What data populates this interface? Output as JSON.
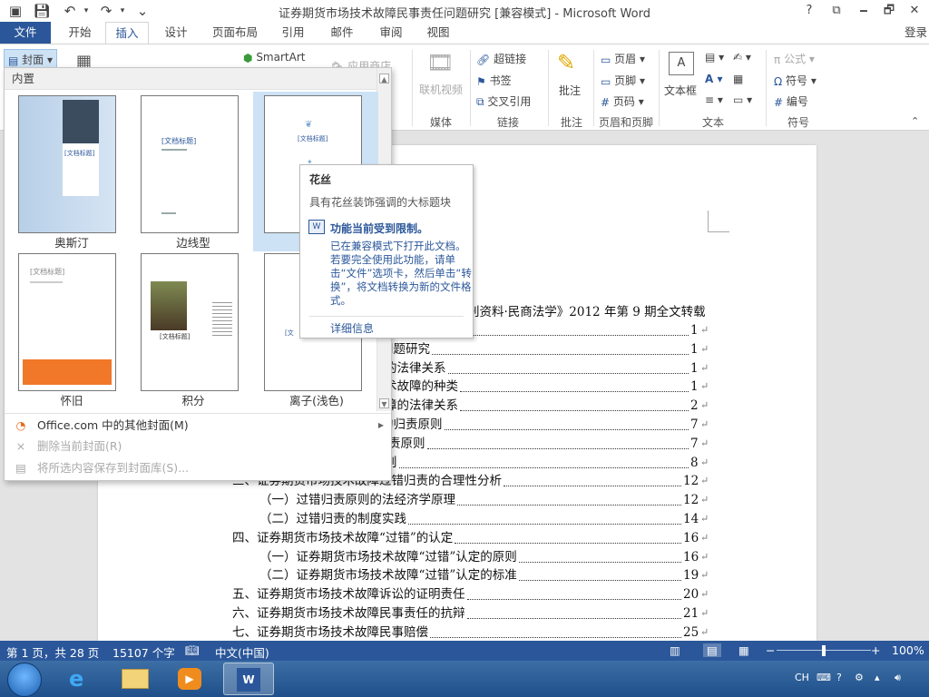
{
  "app": {
    "title": "证券期货市场技术故障民事责任问题研究 [兼容模式] - Microsoft Word",
    "window_buttons": [
      "?",
      "⧉",
      "🗕",
      "🗗",
      "✕"
    ]
  },
  "tabs": {
    "file": "文件",
    "items": [
      "开始",
      "插入",
      "设计",
      "页面布局",
      "引用",
      "邮件",
      "审阅",
      "视图"
    ],
    "active": "插入",
    "login": "登录"
  },
  "ribbon": {
    "cover_button": "封面",
    "smartart": "SmartArt",
    "app_store": "应用商店",
    "online_video": "联机视频",
    "media_group": "媒体",
    "hyperlink": "超链接",
    "bookmark": "书签",
    "cross_ref": "交叉引用",
    "links_group": "链接",
    "comment": "批注",
    "comment_group": "批注",
    "header": "页眉",
    "footer": "页脚",
    "page_number": "页码",
    "header_footer_group": "页眉和页脚",
    "textbox": "文本框",
    "text_group": "文本",
    "equation": "公式",
    "symbol": "符号",
    "numbering": "编号",
    "symbol_group": "符号"
  },
  "gallery": {
    "header": "内置",
    "covers": [
      {
        "label": "奥斯汀",
        "title": "[文档标题]"
      },
      {
        "label": "边线型",
        "title": "[文档标题]"
      },
      {
        "label": "",
        "title": "[文档标题]"
      },
      {
        "label": "怀旧",
        "title": "[文档标题]"
      },
      {
        "label": "积分",
        "title": "[文档标题]"
      },
      {
        "label": "离子(浅色)",
        "title": "[文"
      }
    ],
    "menu": [
      {
        "label": "Office.com 中的其他封面(M)",
        "enabled": true
      },
      {
        "label": "删除当前封面(R)",
        "enabled": false
      },
      {
        "label": "将所选内容保存到封面库(S)...",
        "enabled": false
      }
    ]
  },
  "tooltip": {
    "title": "花丝",
    "description": "具有花丝装饰强调的大标题块",
    "warning_title": "功能当前受到限制。",
    "warning_body": "已在兼容模式下打开此文档。若要完全使用此功能，请单击“文件”选项卡，然后单击“转换”，将文档转换为新的文件格式。",
    "more_info": "详细信息"
  },
  "document": {
    "source_line": "刊资料·民商法学》2012 年第 9 期全文转载",
    "toc": [
      {
        "text": "",
        "page": "1"
      },
      {
        "text": "问题研究",
        "page": "1"
      },
      {
        "text": "的法律关系",
        "page": "1"
      },
      {
        "text": "术故障的种类",
        "page": "1"
      },
      {
        "text": "障的法律关系",
        "page": "2"
      },
      {
        "text": "的归责原则",
        "page": "7"
      },
      {
        "text": "责原则",
        "page": "7"
      },
      {
        "text": "则",
        "page": "8"
      },
      {
        "text": "三、证券期货市场技术故障过错归责的合理性分析",
        "page": "12"
      },
      {
        "text": "（一）过错归责原则的法经济学原理",
        "page": "12"
      },
      {
        "text": "（二）过错归责的制度实践",
        "page": "14"
      },
      {
        "text": "四、证券期货市场技术故障“过错”的认定",
        "page": "16"
      },
      {
        "text": "（一）证券期货市场技术故障“过错”认定的原则",
        "page": "16"
      },
      {
        "text": "（二）证券期货市场技术故障“过错”认定的标准",
        "page": "19"
      },
      {
        "text": "五、证券期货市场技术故障诉讼的证明责任",
        "page": "20"
      },
      {
        "text": "六、证券期货市场技术故障民事责任的抗辩",
        "page": "21"
      },
      {
        "text": "七、证券期货市场技术故障民事赔偿",
        "page": "25"
      }
    ]
  },
  "status": {
    "page": "第 1 页，共 28 页",
    "words": "15107 个字",
    "language": "中文(中国)",
    "zoom": "100%",
    "zoom_fraction": 0.5
  },
  "taskbar": {
    "ime": "CH"
  }
}
